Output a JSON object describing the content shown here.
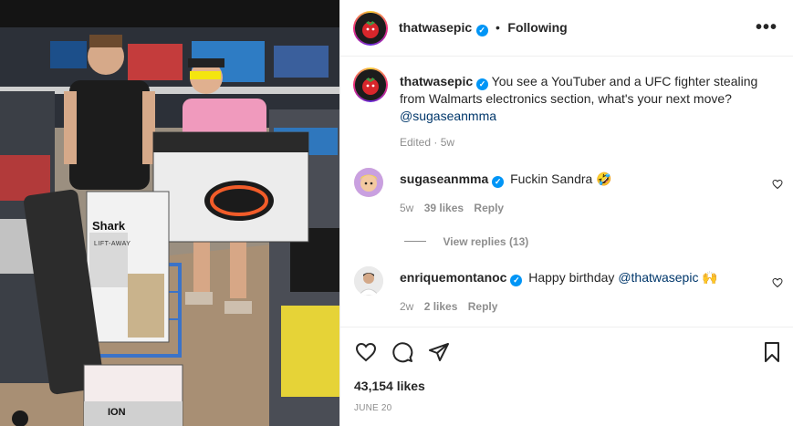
{
  "post_author": {
    "username": "thatwasepic",
    "follow_status": "Following",
    "separator": "•"
  },
  "more_options": "•••",
  "caption": {
    "username": "thatwasepic",
    "text": "You see a YouTuber and a UFC fighter stealing from Walmarts electronics section, what's your next move?",
    "mention": "@sugaseanmma",
    "meta": "Edited · 5w"
  },
  "comments": [
    {
      "username": "sugaseanmma",
      "text": "Fuckin Sandra",
      "emoji": "🤣",
      "age": "5w",
      "likes": "39 likes",
      "reply": "Reply",
      "view_replies": "View replies (13)"
    },
    {
      "username": "enriquemontanoc",
      "text": "Happy birthday",
      "mention": "@thatwasepic",
      "emoji": "🙌",
      "age": "2w",
      "likes": "2 likes",
      "reply": "Reply"
    }
  ],
  "post_stats": {
    "likes": "43,154 likes",
    "date": "JUNE 20"
  },
  "photo": {
    "box_brand_1": "Shark",
    "box_subtitle_1": "LIFT-AWAY",
    "box_brand_2": "ION"
  }
}
